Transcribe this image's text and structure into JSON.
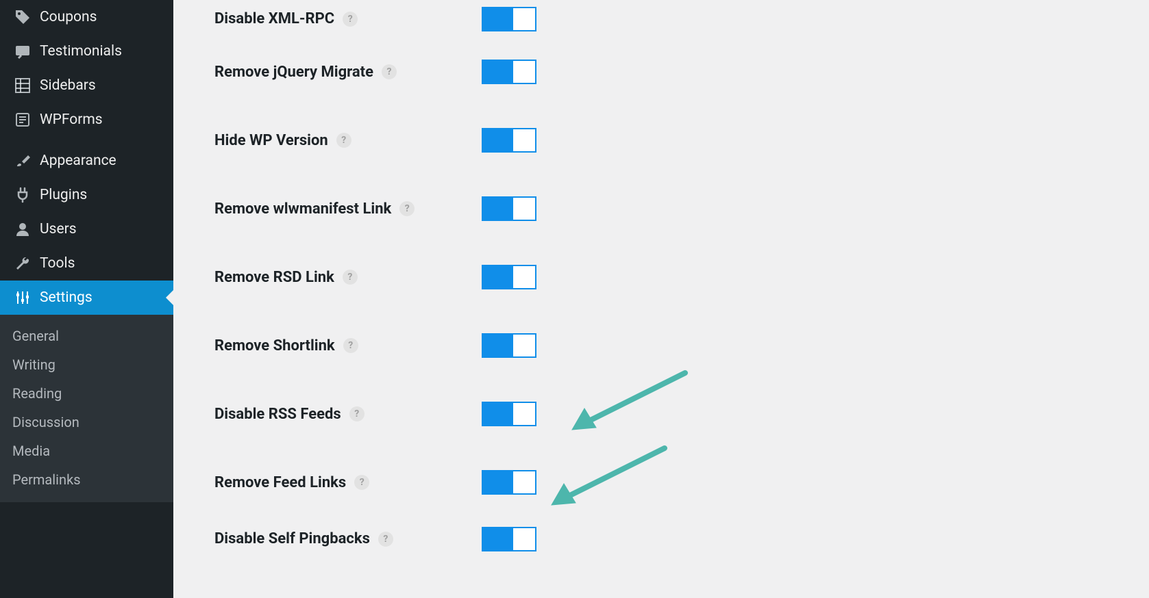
{
  "sidebar": {
    "primary": [
      {
        "id": "coupons",
        "label": "Coupons",
        "icon": "tag"
      },
      {
        "id": "testimonials",
        "label": "Testimonials",
        "icon": "chat"
      },
      {
        "id": "sidebars",
        "label": "Sidebars",
        "icon": "grid"
      },
      {
        "id": "wpforms",
        "label": "WPForms",
        "icon": "form"
      }
    ],
    "secondary": [
      {
        "id": "appearance",
        "label": "Appearance",
        "icon": "brush"
      },
      {
        "id": "plugins",
        "label": "Plugins",
        "icon": "plug"
      },
      {
        "id": "users",
        "label": "Users",
        "icon": "user"
      },
      {
        "id": "tools",
        "label": "Tools",
        "icon": "wrench"
      },
      {
        "id": "settings",
        "label": "Settings",
        "icon": "sliders",
        "active": true
      }
    ],
    "submenu": [
      {
        "id": "general",
        "label": "General"
      },
      {
        "id": "writing",
        "label": "Writing"
      },
      {
        "id": "reading",
        "label": "Reading"
      },
      {
        "id": "discussion",
        "label": "Discussion"
      },
      {
        "id": "media",
        "label": "Media"
      },
      {
        "id": "permalinks",
        "label": "Permalinks"
      }
    ]
  },
  "settings": [
    {
      "id": "disable-xml-rpc",
      "label": "Disable XML-RPC",
      "on": true
    },
    {
      "id": "remove-jquery-migrate",
      "label": "Remove jQuery Migrate",
      "on": true
    },
    {
      "id": "hide-wp-version",
      "label": "Hide WP Version",
      "on": true
    },
    {
      "id": "remove-wlwmanifest-link",
      "label": "Remove wlwmanifest Link",
      "on": true
    },
    {
      "id": "remove-rsd-link",
      "label": "Remove RSD Link",
      "on": true
    },
    {
      "id": "remove-shortlink",
      "label": "Remove Shortlink",
      "on": true
    },
    {
      "id": "disable-rss-feeds",
      "label": "Disable RSS Feeds",
      "on": true,
      "arrow": true
    },
    {
      "id": "remove-feed-links",
      "label": "Remove Feed Links",
      "on": true,
      "arrow": true
    },
    {
      "id": "disable-self-pingbacks",
      "label": "Disable Self Pingbacks",
      "on": true
    }
  ],
  "help_glyph": "?"
}
